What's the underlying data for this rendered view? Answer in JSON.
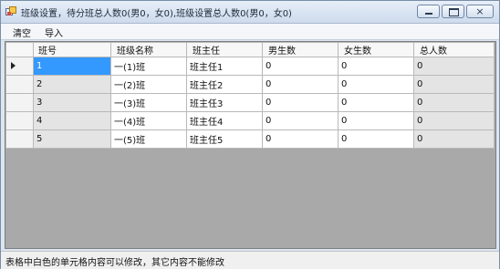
{
  "window": {
    "title": "班级设置，待分班总人数0(男0，女0),班级设置总人数0(男0，女0)",
    "controls": {
      "minimize": "minimize",
      "maximize": "maximize",
      "close": "×"
    }
  },
  "menu": {
    "items": [
      "清空",
      "导入"
    ]
  },
  "grid": {
    "columns": [
      "班号",
      "班级名称",
      "班主任",
      "男生数",
      "女生数",
      "总人数"
    ],
    "rows": [
      [
        "1",
        "一(1)班",
        "班主任1",
        "0",
        "0",
        "0"
      ],
      [
        "2",
        "一(2)班",
        "班主任2",
        "0",
        "0",
        "0"
      ],
      [
        "3",
        "一(3)班",
        "班主任3",
        "0",
        "0",
        "0"
      ],
      [
        "4",
        "一(4)班",
        "班主任4",
        "0",
        "0",
        "0"
      ],
      [
        "5",
        "一(5)班",
        "班主任5",
        "0",
        "0",
        "0"
      ]
    ],
    "current_row_index": 0,
    "selected_cell": {
      "row": 0,
      "column": 0
    },
    "editable_columns": [
      1,
      2,
      3,
      4
    ]
  },
  "status": {
    "text": "表格中白色的单元格内容可以修改，其它内容不能修改"
  },
  "colors": {
    "selection": "#3399ff",
    "readonly_cell": "#e4e4e4",
    "editable_cell": "#ffffff",
    "grid_background": "#a9a9a9"
  }
}
